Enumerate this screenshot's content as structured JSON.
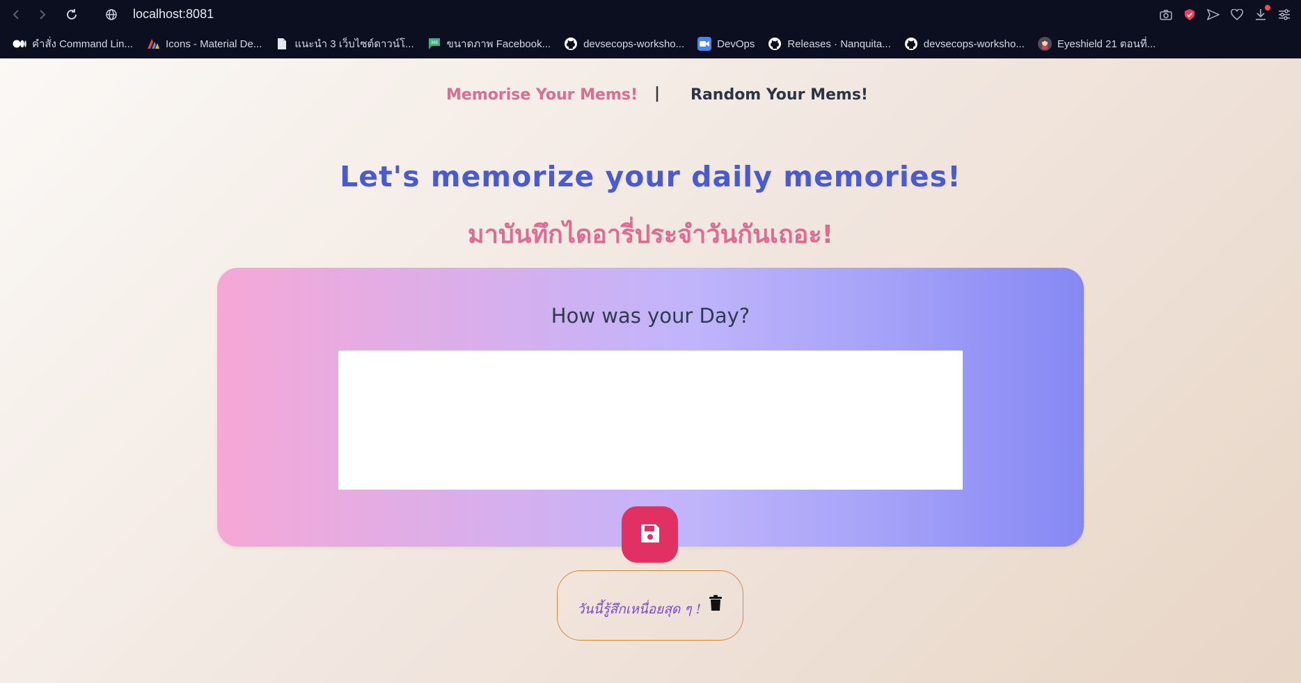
{
  "browser": {
    "url": "localhost:8081",
    "bookmarks": [
      {
        "label": "คำสั่ง Command Lin...",
        "icon": "medium-logo-icon"
      },
      {
        "label": "Icons - Material De...",
        "icon": "material-logo-icon"
      },
      {
        "label": "แนะนำ 3 เว็บไซต์ดาวน์โ...",
        "icon": "document-icon"
      },
      {
        "label": "ขนาดภาพ Facebook...",
        "icon": "flag-logo-icon"
      },
      {
        "label": "devsecops-worksho...",
        "icon": "github-icon"
      },
      {
        "label": "DevOps",
        "icon": "video-icon"
      },
      {
        "label": "Releases · Nanquita...",
        "icon": "github-icon"
      },
      {
        "label": "devsecops-worksho...",
        "icon": "github-icon"
      },
      {
        "label": "Eyeshield 21 ตอนที่...",
        "icon": "anime-avatar-icon"
      }
    ]
  },
  "nav": {
    "memorise": "Memorise Your Mems!",
    "separator": "|",
    "random": "Random Your Mems!"
  },
  "hero": {
    "title_en": "Let's memorize your daily memories!",
    "title_th": "มาบันทึกไดอารี่ประจำวันกันเถอะ!"
  },
  "card": {
    "title": "How was your Day?",
    "textarea_value": ""
  },
  "memo": {
    "text": "วันนี้รู้สึกเหนื่อยสุด ๆ !"
  },
  "colors": {
    "accent_pink": "#de6b91",
    "accent_blue": "#4a5bd0",
    "save_button": "#e13163",
    "memo_border": "#d8893a",
    "memo_text": "#7b48d8"
  }
}
